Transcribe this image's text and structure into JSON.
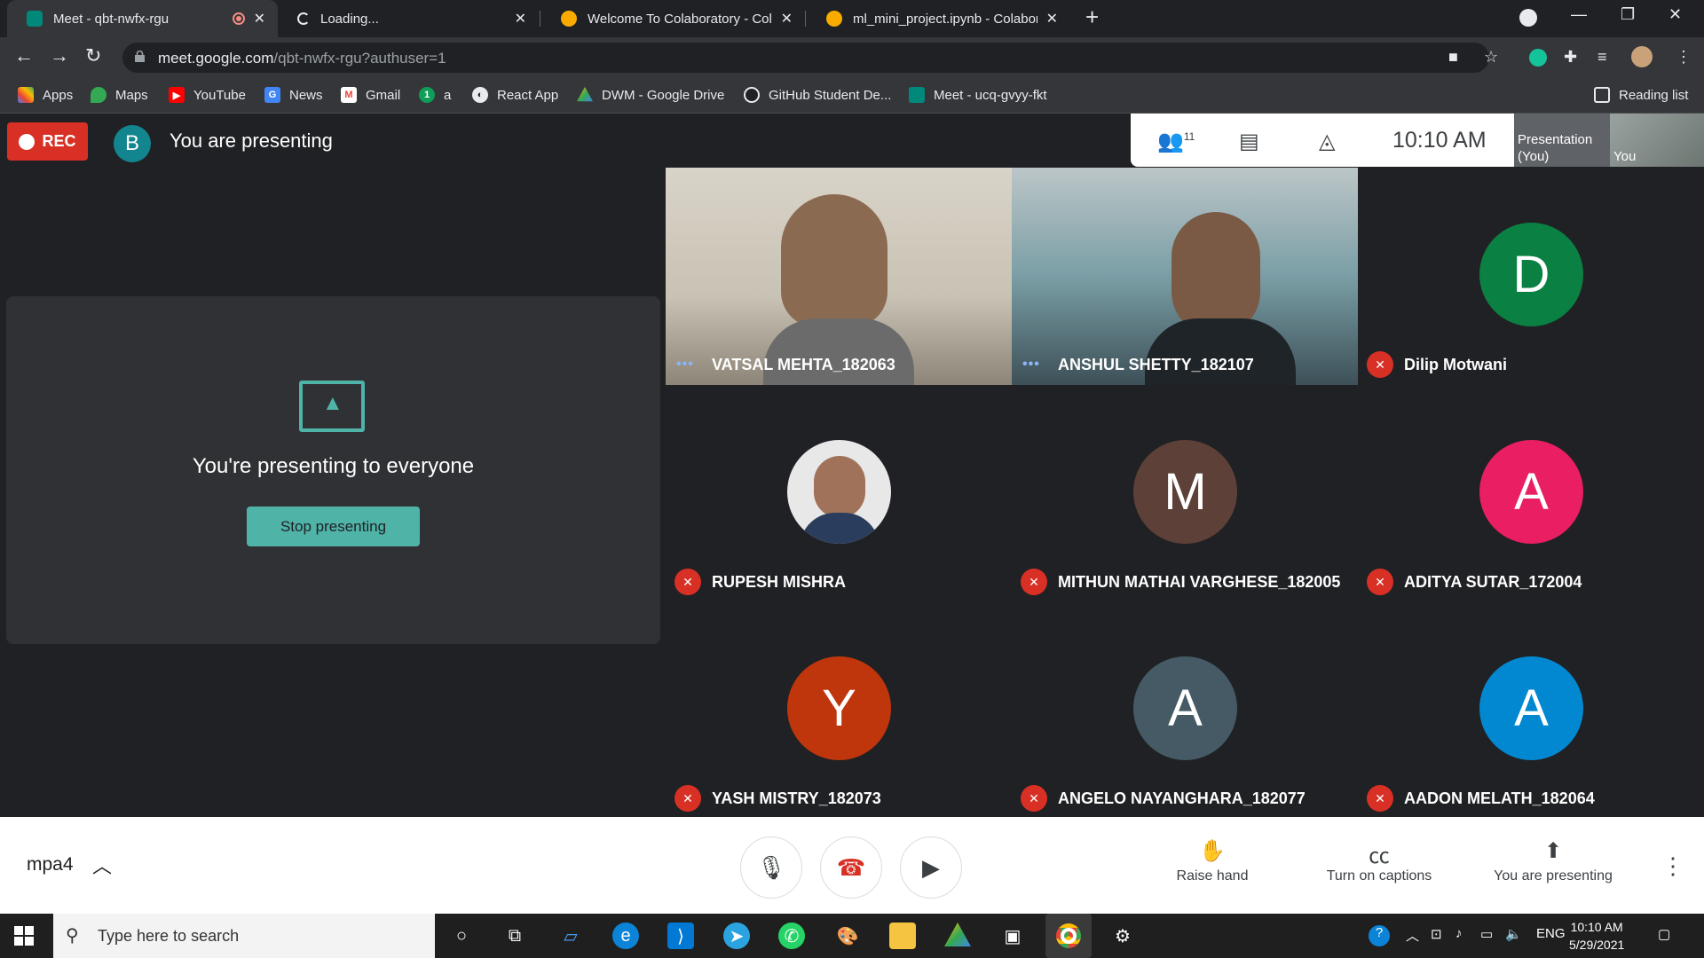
{
  "browser": {
    "tabs": [
      {
        "title": "Meet - qbt-nwfx-rgu",
        "active": true
      },
      {
        "title": "Loading...",
        "active": false
      },
      {
        "title": "Welcome To Colaboratory - Colab",
        "active": false
      },
      {
        "title": "ml_mini_project.ipynb - Colaboratory",
        "active": false
      }
    ],
    "url_host": "meet.google.com",
    "url_path": "/qbt-nwfx-rgu?authuser=1",
    "bookmarks": [
      "Apps",
      "Maps",
      "YouTube",
      "News",
      "Gmail",
      "a",
      "React App",
      "DWM - Google Drive",
      "GitHub Student De...",
      "Meet - ucq-gvyy-fkt"
    ],
    "reading_list": "Reading list"
  },
  "meet": {
    "rec_label": "REC",
    "presenter_initial": "B",
    "presenting_banner": "You are presenting",
    "participant_count": "11",
    "time": "10:10  AM",
    "self_tile_label": "Presentation (You)",
    "self_label": "You",
    "present_card": {
      "message": "You're presenting to everyone",
      "stop_button": "Stop presenting"
    },
    "participants": [
      {
        "name": "VATSAL MEHTA_182063",
        "video": true,
        "muted": false
      },
      {
        "name": "ANSHUL SHETTY_182107",
        "video": true,
        "muted": false
      },
      {
        "name": "Dilip Motwani",
        "initial": "D",
        "color": "#0b8043",
        "muted": true
      },
      {
        "name": "RUPESH MISHRA",
        "photo": true,
        "muted": true
      },
      {
        "name": "MITHUN MATHAI VARGHESE_182005",
        "initial": "M",
        "color": "#5d4037",
        "muted": true
      },
      {
        "name": "ADITYA SUTAR_172004",
        "initial": "A",
        "color": "#e91e63",
        "muted": true
      },
      {
        "name": "YASH MISTRY_182073",
        "initial": "Y",
        "color": "#bf360c",
        "muted": true
      },
      {
        "name": "ANGELO NAYANGHARA_182077",
        "initial": "A",
        "color": "#455a64",
        "muted": true
      },
      {
        "name": "AADON MELATH_182064",
        "initial": "A",
        "color": "#0288d1",
        "muted": true
      }
    ],
    "controls": {
      "meeting_code": "mpa4",
      "raise_hand": "Raise hand",
      "captions": "Turn on captions",
      "presenting": "You are presenting"
    }
  },
  "taskbar": {
    "search_placeholder": "Type here to search",
    "lang": "ENG",
    "time": "10:10 AM",
    "date": "5/29/2021"
  }
}
